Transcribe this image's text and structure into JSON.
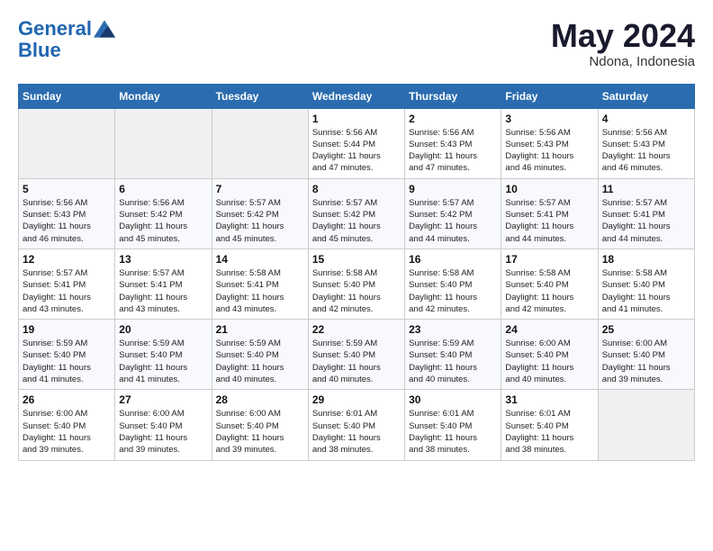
{
  "logo": {
    "line1": "General",
    "line2": "Blue"
  },
  "title": "May 2024",
  "location": "Ndona, Indonesia",
  "days_of_week": [
    "Sunday",
    "Monday",
    "Tuesday",
    "Wednesday",
    "Thursday",
    "Friday",
    "Saturday"
  ],
  "weeks": [
    [
      {
        "day": "",
        "info": ""
      },
      {
        "day": "",
        "info": ""
      },
      {
        "day": "",
        "info": ""
      },
      {
        "day": "1",
        "info": "Sunrise: 5:56 AM\nSunset: 5:44 PM\nDaylight: 11 hours\nand 47 minutes."
      },
      {
        "day": "2",
        "info": "Sunrise: 5:56 AM\nSunset: 5:43 PM\nDaylight: 11 hours\nand 47 minutes."
      },
      {
        "day": "3",
        "info": "Sunrise: 5:56 AM\nSunset: 5:43 PM\nDaylight: 11 hours\nand 46 minutes."
      },
      {
        "day": "4",
        "info": "Sunrise: 5:56 AM\nSunset: 5:43 PM\nDaylight: 11 hours\nand 46 minutes."
      }
    ],
    [
      {
        "day": "5",
        "info": "Sunrise: 5:56 AM\nSunset: 5:43 PM\nDaylight: 11 hours\nand 46 minutes."
      },
      {
        "day": "6",
        "info": "Sunrise: 5:56 AM\nSunset: 5:42 PM\nDaylight: 11 hours\nand 45 minutes."
      },
      {
        "day": "7",
        "info": "Sunrise: 5:57 AM\nSunset: 5:42 PM\nDaylight: 11 hours\nand 45 minutes."
      },
      {
        "day": "8",
        "info": "Sunrise: 5:57 AM\nSunset: 5:42 PM\nDaylight: 11 hours\nand 45 minutes."
      },
      {
        "day": "9",
        "info": "Sunrise: 5:57 AM\nSunset: 5:42 PM\nDaylight: 11 hours\nand 44 minutes."
      },
      {
        "day": "10",
        "info": "Sunrise: 5:57 AM\nSunset: 5:41 PM\nDaylight: 11 hours\nand 44 minutes."
      },
      {
        "day": "11",
        "info": "Sunrise: 5:57 AM\nSunset: 5:41 PM\nDaylight: 11 hours\nand 44 minutes."
      }
    ],
    [
      {
        "day": "12",
        "info": "Sunrise: 5:57 AM\nSunset: 5:41 PM\nDaylight: 11 hours\nand 43 minutes."
      },
      {
        "day": "13",
        "info": "Sunrise: 5:57 AM\nSunset: 5:41 PM\nDaylight: 11 hours\nand 43 minutes."
      },
      {
        "day": "14",
        "info": "Sunrise: 5:58 AM\nSunset: 5:41 PM\nDaylight: 11 hours\nand 43 minutes."
      },
      {
        "day": "15",
        "info": "Sunrise: 5:58 AM\nSunset: 5:40 PM\nDaylight: 11 hours\nand 42 minutes."
      },
      {
        "day": "16",
        "info": "Sunrise: 5:58 AM\nSunset: 5:40 PM\nDaylight: 11 hours\nand 42 minutes."
      },
      {
        "day": "17",
        "info": "Sunrise: 5:58 AM\nSunset: 5:40 PM\nDaylight: 11 hours\nand 42 minutes."
      },
      {
        "day": "18",
        "info": "Sunrise: 5:58 AM\nSunset: 5:40 PM\nDaylight: 11 hours\nand 41 minutes."
      }
    ],
    [
      {
        "day": "19",
        "info": "Sunrise: 5:59 AM\nSunset: 5:40 PM\nDaylight: 11 hours\nand 41 minutes."
      },
      {
        "day": "20",
        "info": "Sunrise: 5:59 AM\nSunset: 5:40 PM\nDaylight: 11 hours\nand 41 minutes."
      },
      {
        "day": "21",
        "info": "Sunrise: 5:59 AM\nSunset: 5:40 PM\nDaylight: 11 hours\nand 40 minutes."
      },
      {
        "day": "22",
        "info": "Sunrise: 5:59 AM\nSunset: 5:40 PM\nDaylight: 11 hours\nand 40 minutes."
      },
      {
        "day": "23",
        "info": "Sunrise: 5:59 AM\nSunset: 5:40 PM\nDaylight: 11 hours\nand 40 minutes."
      },
      {
        "day": "24",
        "info": "Sunrise: 6:00 AM\nSunset: 5:40 PM\nDaylight: 11 hours\nand 40 minutes."
      },
      {
        "day": "25",
        "info": "Sunrise: 6:00 AM\nSunset: 5:40 PM\nDaylight: 11 hours\nand 39 minutes."
      }
    ],
    [
      {
        "day": "26",
        "info": "Sunrise: 6:00 AM\nSunset: 5:40 PM\nDaylight: 11 hours\nand 39 minutes."
      },
      {
        "day": "27",
        "info": "Sunrise: 6:00 AM\nSunset: 5:40 PM\nDaylight: 11 hours\nand 39 minutes."
      },
      {
        "day": "28",
        "info": "Sunrise: 6:00 AM\nSunset: 5:40 PM\nDaylight: 11 hours\nand 39 minutes."
      },
      {
        "day": "29",
        "info": "Sunrise: 6:01 AM\nSunset: 5:40 PM\nDaylight: 11 hours\nand 38 minutes."
      },
      {
        "day": "30",
        "info": "Sunrise: 6:01 AM\nSunset: 5:40 PM\nDaylight: 11 hours\nand 38 minutes."
      },
      {
        "day": "31",
        "info": "Sunrise: 6:01 AM\nSunset: 5:40 PM\nDaylight: 11 hours\nand 38 minutes."
      },
      {
        "day": "",
        "info": ""
      }
    ]
  ]
}
